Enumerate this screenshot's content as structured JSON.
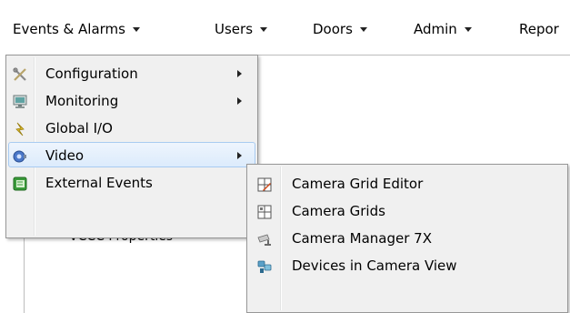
{
  "menubar": {
    "items": [
      {
        "label": "Events & Alarms",
        "icon": "chevron-down-icon"
      },
      {
        "label": "Users",
        "icon": "chevron-down-icon"
      },
      {
        "label": "Doors",
        "icon": "chevron-down-icon"
      },
      {
        "label": "Admin",
        "icon": "chevron-down-icon"
      },
      {
        "label": "Repor",
        "icon": null
      }
    ]
  },
  "background": {
    "partial_text": "VCCC Properties"
  },
  "menu": {
    "items": [
      {
        "label": "Configuration",
        "icon": "tools-icon",
        "has_submenu": true
      },
      {
        "label": "Monitoring",
        "icon": "monitor-icon",
        "has_submenu": true
      },
      {
        "label": "Global I/O",
        "icon": "global-io-icon",
        "has_submenu": false
      },
      {
        "label": "Video",
        "icon": "video-camera-icon",
        "has_submenu": true,
        "highlighted": true
      },
      {
        "label": "External Events",
        "icon": "external-events-icon",
        "has_submenu": false
      }
    ]
  },
  "submenu": {
    "items": [
      {
        "label": "Camera Grid Editor",
        "icon": "camera-grid-editor-icon"
      },
      {
        "label": "Camera Grids",
        "icon": "camera-grids-icon"
      },
      {
        "label": "Camera Manager 7X",
        "icon": "security-camera-icon"
      },
      {
        "label": "Devices in Camera View",
        "icon": "devices-camera-view-icon"
      }
    ]
  },
  "colors": {
    "menu_bg": "#f0f0f0",
    "highlight_border": "#a8cbf1",
    "highlight_bg": "#dcebfc"
  }
}
